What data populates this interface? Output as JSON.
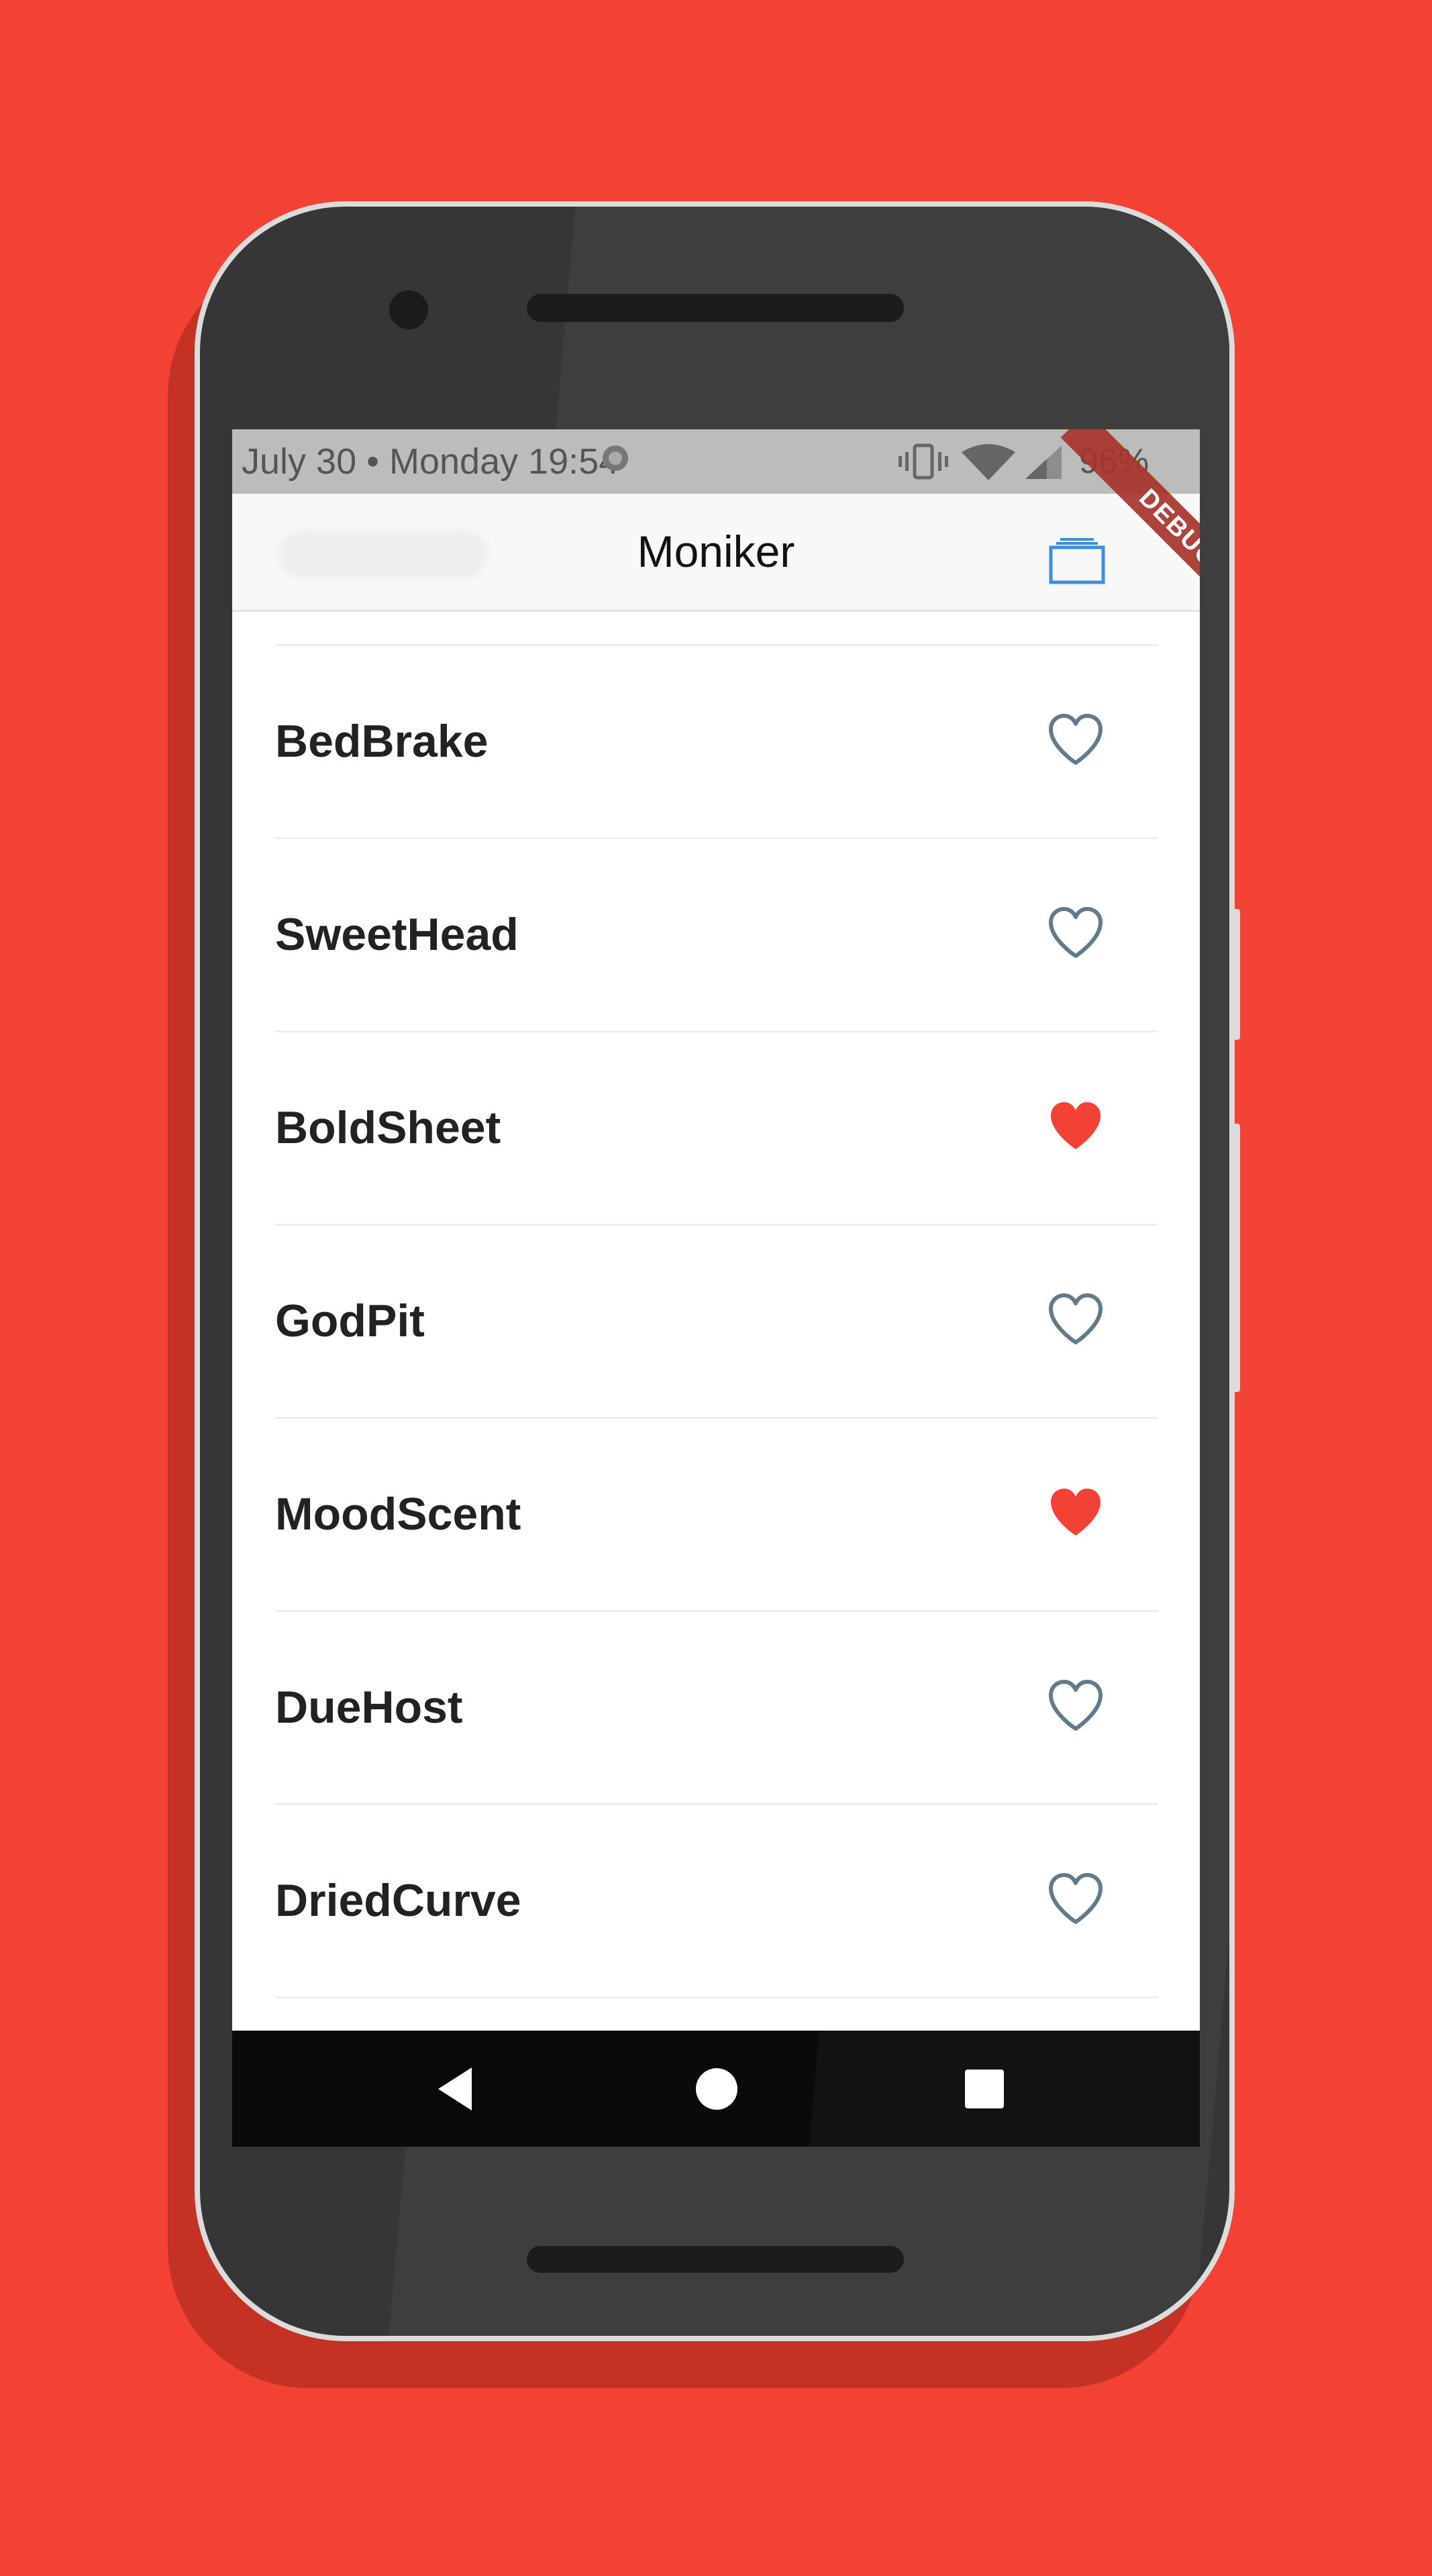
{
  "status_bar": {
    "datetime": "July 30 • Monday 19:54",
    "battery": "96%"
  },
  "app_bar": {
    "title": "Moniker",
    "action_icon": "saved-list-icon",
    "debug_banner": "DEBUG"
  },
  "words": [
    {
      "name": "BedBrake",
      "saved": false
    },
    {
      "name": "SweetHead",
      "saved": false
    },
    {
      "name": "BoldSheet",
      "saved": true
    },
    {
      "name": "GodPit",
      "saved": false
    },
    {
      "name": "MoodScent",
      "saved": true
    },
    {
      "name": "DueHost",
      "saved": false
    },
    {
      "name": "DriedCurve",
      "saved": false
    }
  ],
  "nav_bar": {
    "back_icon": "back-triangle-icon",
    "home_icon": "home-circle-icon",
    "recents_icon": "recents-square-icon"
  },
  "colors": {
    "background": "#f14235",
    "heart_saved": "#f14235",
    "heart_unsaved": "#627b8c",
    "action_icon": "#3d8ede"
  }
}
